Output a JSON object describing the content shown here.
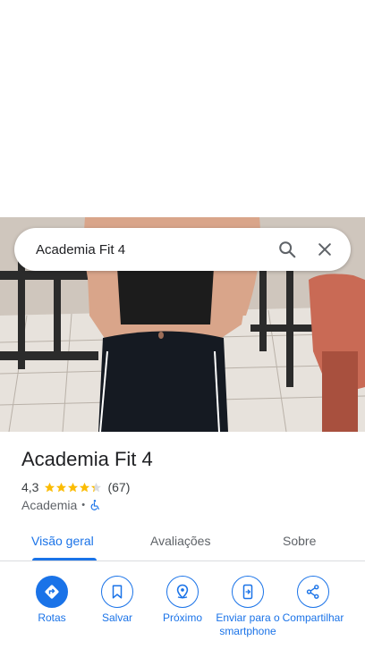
{
  "search": {
    "query": "Academia Fit 4"
  },
  "place": {
    "name": "Academia Fit 4",
    "rating": "4,3",
    "rating_value": 4.3,
    "rating_max": 5,
    "reviews_count": "(67)",
    "category": "Academia",
    "separator": "•",
    "star_color": "#fbbc04"
  },
  "tabs": [
    {
      "label": "Visão geral",
      "active": true
    },
    {
      "label": "Avaliações",
      "active": false
    },
    {
      "label": "Sobre",
      "active": false
    }
  ],
  "actions": [
    {
      "label": "Rotas",
      "icon": "directions-icon"
    },
    {
      "label": "Salvar",
      "icon": "bookmark-icon"
    },
    {
      "label": "Próximo",
      "icon": "nearby-icon"
    },
    {
      "label": "Enviar para o smartphone",
      "icon": "send-to-phone-icon"
    },
    {
      "label": "Compartilhar",
      "icon": "share-icon"
    }
  ],
  "colors": {
    "accent": "#1a73e8",
    "star": "#fbbc04"
  }
}
